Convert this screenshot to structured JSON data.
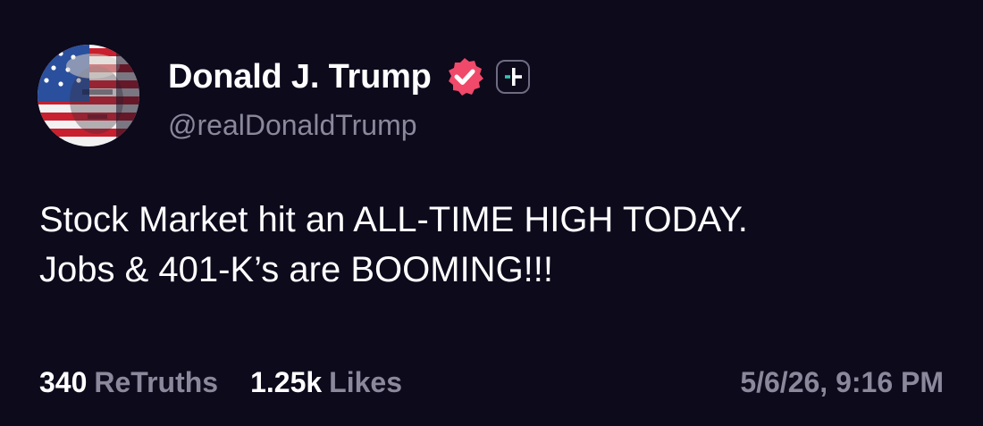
{
  "author": {
    "display_name": "Donald J. Trump",
    "handle": "@realDonaldTrump",
    "avatar_icon": "avatar",
    "verified_icon": "verified-badge-icon",
    "plus_icon": "plus-badge-icon"
  },
  "post": {
    "lines": [
      "Stock Market hit an ALL-TIME HIGH TODAY.",
      "Jobs & 401-K’s are BOOMING!!!"
    ]
  },
  "stats": {
    "retruths_count": "340",
    "retruths_label": "ReTruths",
    "likes_count": "1.25k",
    "likes_label": "Likes"
  },
  "timestamp": "5/6/26, 9:16 PM",
  "colors": {
    "background": "#0c0a1b",
    "text": "#ffffff",
    "muted": "#8b889c",
    "verified_badge": "#f0496a",
    "plus_accent": "#32c5b4"
  }
}
